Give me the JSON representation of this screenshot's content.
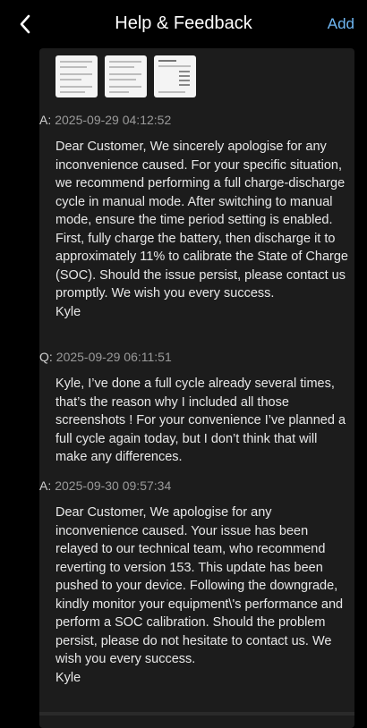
{
  "header": {
    "title": "Help & Feedback",
    "add_label": "Add",
    "back_icon": "chevron-left-icon",
    "accent_color": "#6fb7f3"
  },
  "thread": [
    {
      "role": "A:",
      "timestamp": "2025-09-29 04:12:52",
      "body": "Dear Customer, We sincerely apologise for any inconvenience caused. For your specific situation, we recommend performing a full charge-discharge cycle in manual mode. After switching to manual mode, ensure the time period setting is enabled. First, fully charge the battery, then discharge it to approximately 11% to calibrate the State of Charge (SOC). Should the issue persist, please contact us promptly. We wish you every success.",
      "signature": "Kyle"
    },
    {
      "role": "Q:",
      "timestamp": "2025-09-29 06:11:51",
      "body": "Kyle, I’ve done a full cycle already several times, that’s the reason why I included all those screenshots ! For your convenience I’ve planned a full cycle again today, but I don’t think that will make any differences.",
      "signature": ""
    },
    {
      "role": "A:",
      "timestamp": "2025-09-30 09:57:34",
      "body": "Dear Customer, We apologise for any inconvenience caused. Your issue has been relayed to our technical team, who recommend reverting to version 153. This update has been pushed to your device. Following the downgrade, kindly monitor your equipment\\'s performance and perform a SOC calibration. Should the problem persist, please do not hesitate to contact us. We wish you every success.",
      "signature": "Kyle"
    }
  ]
}
